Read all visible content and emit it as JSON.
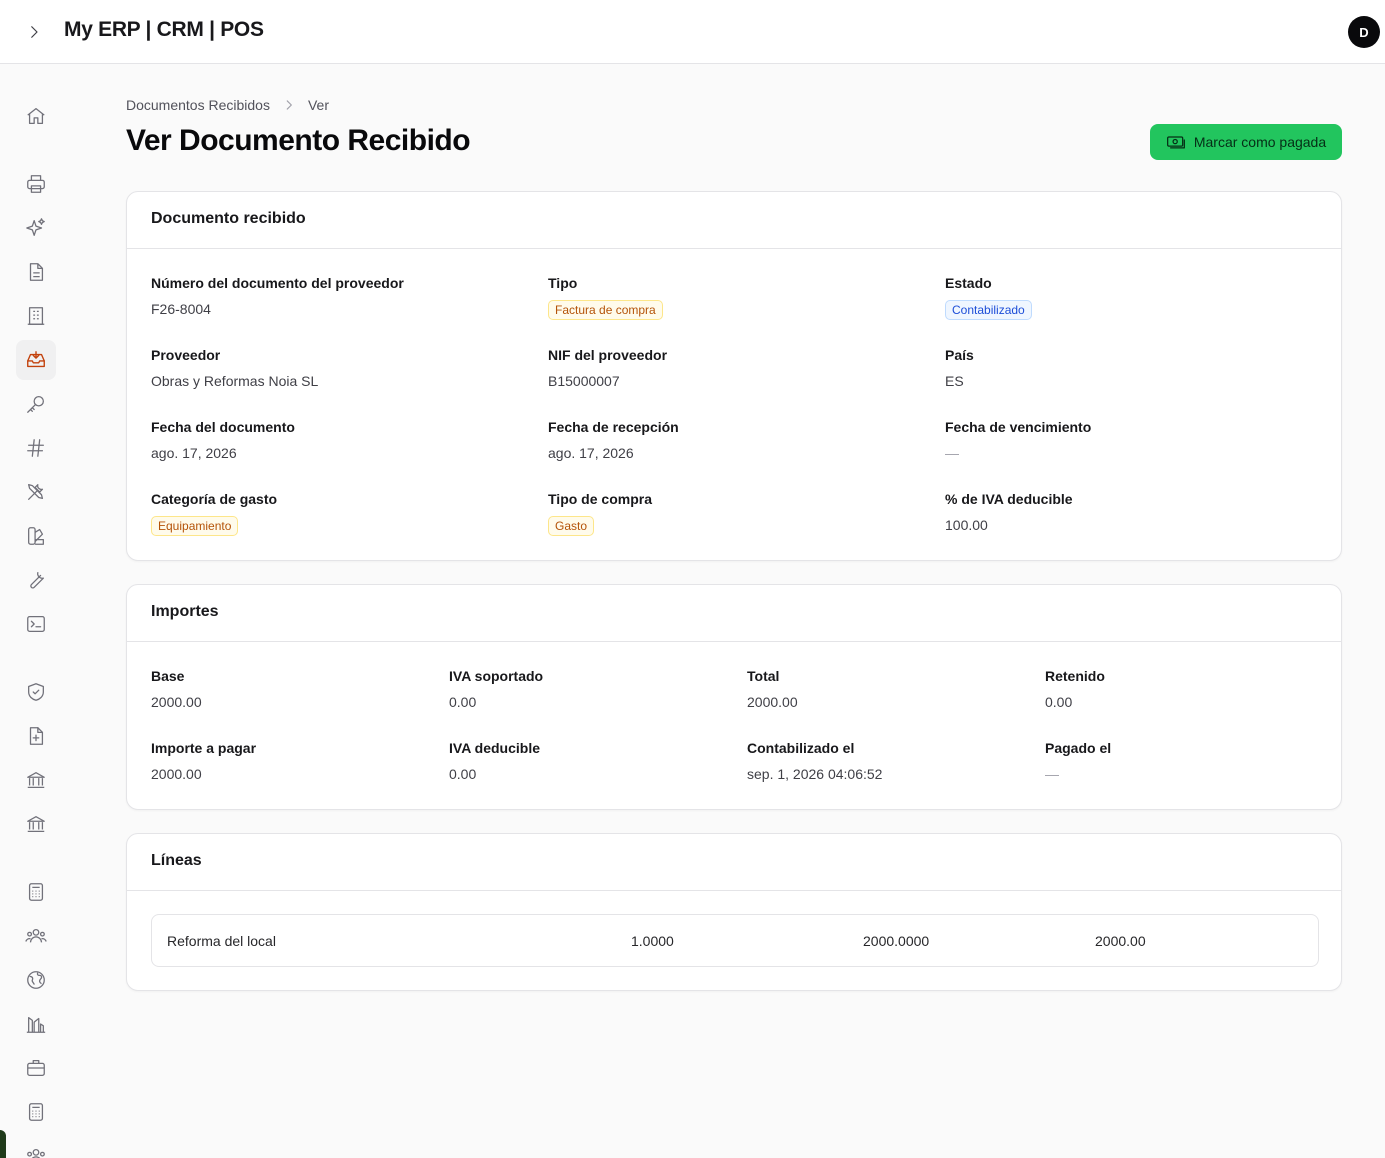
{
  "app": {
    "title": "My ERP | CRM | POS",
    "user_initial": "D"
  },
  "sidebar": {
    "items": [
      {
        "icon": "home-icon"
      },
      {
        "icon": "printer-icon"
      },
      {
        "icon": "sparkles-icon"
      },
      {
        "icon": "document-icon"
      },
      {
        "icon": "building-icon"
      },
      {
        "icon": "inbox-download-icon",
        "active": true
      },
      {
        "icon": "key-icon"
      },
      {
        "icon": "hashtag-icon"
      },
      {
        "icon": "tools-icon"
      },
      {
        "icon": "swatch-icon"
      },
      {
        "icon": "wrench-icon"
      },
      {
        "icon": "terminal-icon"
      },
      {
        "icon": "shield-check-icon"
      },
      {
        "icon": "document-plus-icon"
      },
      {
        "icon": "bank-icon"
      },
      {
        "icon": "bank-icon"
      },
      {
        "icon": "calculator-icon"
      },
      {
        "icon": "user-group-icon"
      },
      {
        "icon": "globe-icon"
      },
      {
        "icon": "chart-building-icon"
      },
      {
        "icon": "briefcase-icon"
      },
      {
        "icon": "calculator-icon"
      },
      {
        "icon": "user-group-icon"
      }
    ]
  },
  "breadcrumb": {
    "parent": "Documentos Recibidos",
    "current": "Ver"
  },
  "page": {
    "title": "Ver Documento Recibido",
    "pay_button": "Marcar como pagada"
  },
  "colors": {
    "accent": "#22c55e",
    "amber_badge": "#b45309",
    "blue_badge": "#1d4ed8",
    "active_icon": "#c2410c"
  },
  "document": {
    "heading": "Documento recibido",
    "supplier_doc_number": {
      "label": "Número del documento del proveedor",
      "value": "F26-8004"
    },
    "type": {
      "label": "Tipo",
      "value": "Factura de compra"
    },
    "status": {
      "label": "Estado",
      "value": "Contabilizado"
    },
    "supplier": {
      "label": "Proveedor",
      "value": "Obras y Reformas Noia SL"
    },
    "supplier_nif": {
      "label": "NIF del proveedor",
      "value": "B15000007"
    },
    "country": {
      "label": "País",
      "value": "ES"
    },
    "doc_date": {
      "label": "Fecha del documento",
      "value": "ago. 17, 2026"
    },
    "reception_date": {
      "label": "Fecha de recepción",
      "value": "ago. 17, 2026"
    },
    "due_date": {
      "label": "Fecha de vencimiento",
      "value": "—"
    },
    "expense_category": {
      "label": "Categoría de gasto",
      "value": "Equipamiento"
    },
    "purchase_type": {
      "label": "Tipo de compra",
      "value": "Gasto"
    },
    "deductible_vat_pct": {
      "label": "% de IVA deducible",
      "value": "100.00"
    }
  },
  "amounts": {
    "heading": "Importes",
    "base": {
      "label": "Base",
      "value": "2000.00"
    },
    "vat_input": {
      "label": "IVA soportado",
      "value": "0.00"
    },
    "total": {
      "label": "Total",
      "value": "2000.00"
    },
    "withheld": {
      "label": "Retenido",
      "value": "0.00"
    },
    "amount_payable": {
      "label": "Importe a pagar",
      "value": "2000.00"
    },
    "vat_deductible": {
      "label": "IVA deducible",
      "value": "0.00"
    },
    "posted_at": {
      "label": "Contabilizado el",
      "value": "sep. 1, 2026 04:06:52"
    },
    "paid_at": {
      "label": "Pagado el",
      "value": "—"
    }
  },
  "lines": {
    "heading": "Líneas",
    "rows": [
      {
        "description": "Reforma del local",
        "quantity": "1.0000",
        "unit_price": "2000.0000",
        "total": "2000.00"
      }
    ]
  }
}
